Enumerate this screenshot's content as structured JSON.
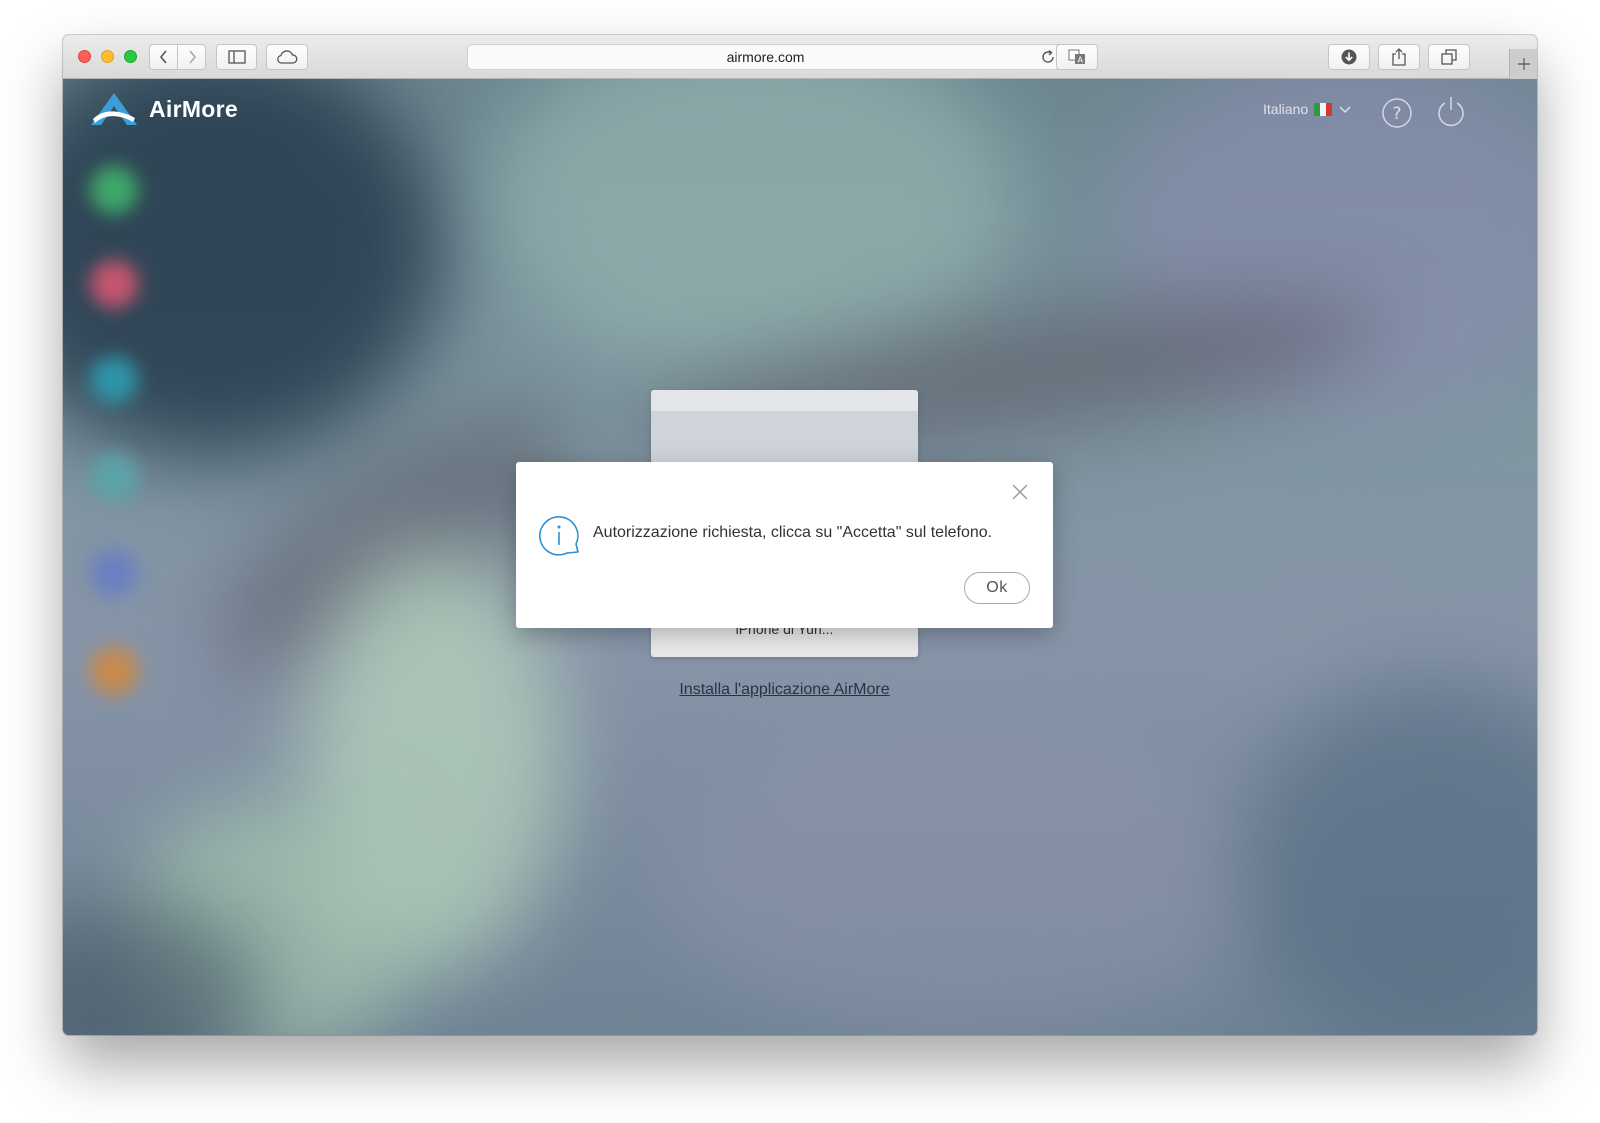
{
  "browser": {
    "url": "airmore.com",
    "icons": {
      "back": "chevron-left-icon",
      "forward": "chevron-right-icon",
      "sidebar": "sidebar-icon",
      "cloud": "icloud-tabs-icon",
      "reload": "reload-icon",
      "translate": "translate-icon",
      "download": "download-icon",
      "share": "share-icon",
      "tabs": "tabs-overview-icon",
      "new_tab": "plus-icon"
    }
  },
  "header": {
    "app_name": "AirMore",
    "language": "Italiano",
    "language_flag": "italy-flag-icon",
    "help": "help-icon",
    "power": "power-icon"
  },
  "main": {
    "device_name": "iPhone di Yuri...",
    "install_link": "Installa l'applicazione AirMore"
  },
  "dialog": {
    "message": "Autorizzazione richiesta, clicca su \"Accetta\" sul telefono.",
    "ok_label": "Ok",
    "icon": "info-icon",
    "close": "close-icon"
  },
  "colors": {
    "accent": "#2f8fce",
    "dialog_bg": "#ffffff",
    "flag_green": "#2e9a48",
    "flag_white": "#f4f4f4",
    "flag_red": "#d33a2f"
  }
}
